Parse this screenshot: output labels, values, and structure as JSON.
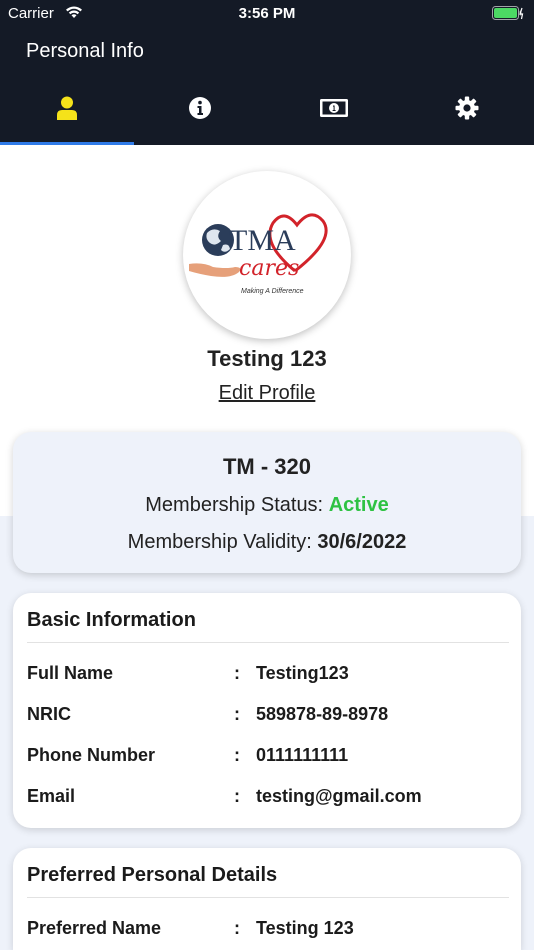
{
  "status_bar": {
    "carrier": "Carrier",
    "time": "3:56 PM"
  },
  "nav": {
    "title": "Personal Info"
  },
  "tabs": [
    {
      "icon": "user-icon",
      "active": true
    },
    {
      "icon": "info-icon",
      "active": false
    },
    {
      "icon": "money-icon",
      "active": false
    },
    {
      "icon": "gear-icon",
      "active": false
    }
  ],
  "logo": {
    "brand": "TMA",
    "sub": "cares",
    "tagline": "Making A Difference"
  },
  "profile": {
    "name": "Testing 123",
    "edit_label": "Edit Profile"
  },
  "membership": {
    "id": "TM - 320",
    "status_label": "Membership Status:",
    "status_value": "Active",
    "validity_label": "Membership Validity:",
    "validity_value": "30/6/2022"
  },
  "basic_info": {
    "title": "Basic Information",
    "rows": [
      {
        "label": "Full Name",
        "value": "Testing123"
      },
      {
        "label": "NRIC",
        "value": "589878-89-8978"
      },
      {
        "label": "Phone Number",
        "value": "0111111111"
      },
      {
        "label": "Email",
        "value": "testing@gmail.com"
      }
    ]
  },
  "preferred": {
    "title": "Preferred Personal Details",
    "rows": [
      {
        "label": "Preferred Name",
        "value": "Testing 123"
      }
    ]
  },
  "colon": ":",
  "colors": {
    "accent": "#2f7be8",
    "active": "#2ec243",
    "header": "#141a26",
    "tab_active_icon": "#f5e21a"
  }
}
